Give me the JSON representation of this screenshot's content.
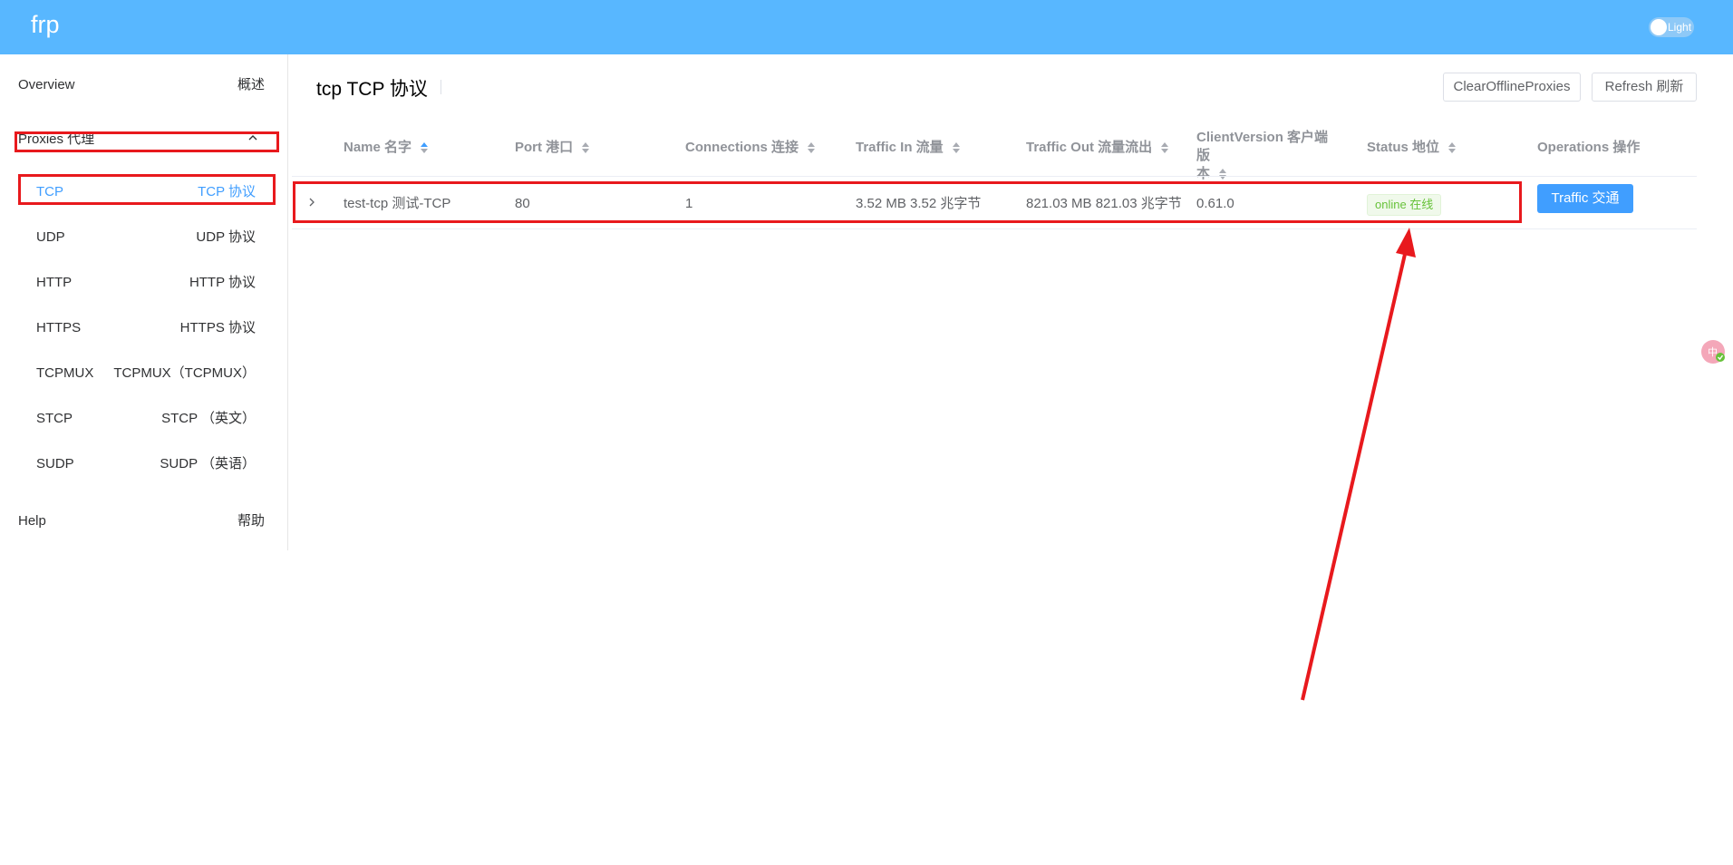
{
  "header": {
    "logo": "frp",
    "theme_label": "Light"
  },
  "sidebar": {
    "overview": {
      "label": "Overview",
      "label_cn": "概述"
    },
    "proxies": {
      "label": "Proxies 代理"
    },
    "items": [
      {
        "label": "TCP",
        "label_cn": "TCP 协议",
        "active": true
      },
      {
        "label": "UDP",
        "label_cn": "UDP 协议"
      },
      {
        "label": "HTTP",
        "label_cn": "HTTP 协议"
      },
      {
        "label": "HTTPS",
        "label_cn": "HTTPS 协议"
      },
      {
        "label": "TCPMUX",
        "label_cn": "TCPMUX（TCPMUX）"
      },
      {
        "label": "STCP",
        "label_cn": "STCP （英文）"
      },
      {
        "label": "SUDP",
        "label_cn": "SUDP （英语）"
      }
    ],
    "help": {
      "label": "Help",
      "label_cn": "帮助"
    }
  },
  "main": {
    "title": "tcp TCP 协议",
    "clear_button": "ClearOfflineProxies",
    "refresh_button": "Refresh 刷新",
    "columns": [
      "Name 名字",
      "Port 港口",
      "Connections 连接",
      "Traffic In 流量",
      "Traffic Out 流量流出",
      "ClientVersion 客户端版",
      "本",
      "Status 地位",
      "Operations 操作"
    ],
    "row": {
      "name": "test-tcp 测试-TCP",
      "port": "80",
      "connections": "1",
      "traffic_in": "3.52 MB 3.52 兆字节",
      "traffic_out": "821.03 MB 821.03 兆字节",
      "client_version": "0.61.0",
      "status": "online 在线",
      "operation": "Traffic 交通"
    }
  },
  "colors": {
    "header": "#58b7ff",
    "primary": "#409eff",
    "annotation": "#e8191d",
    "online": "#67c23a"
  }
}
